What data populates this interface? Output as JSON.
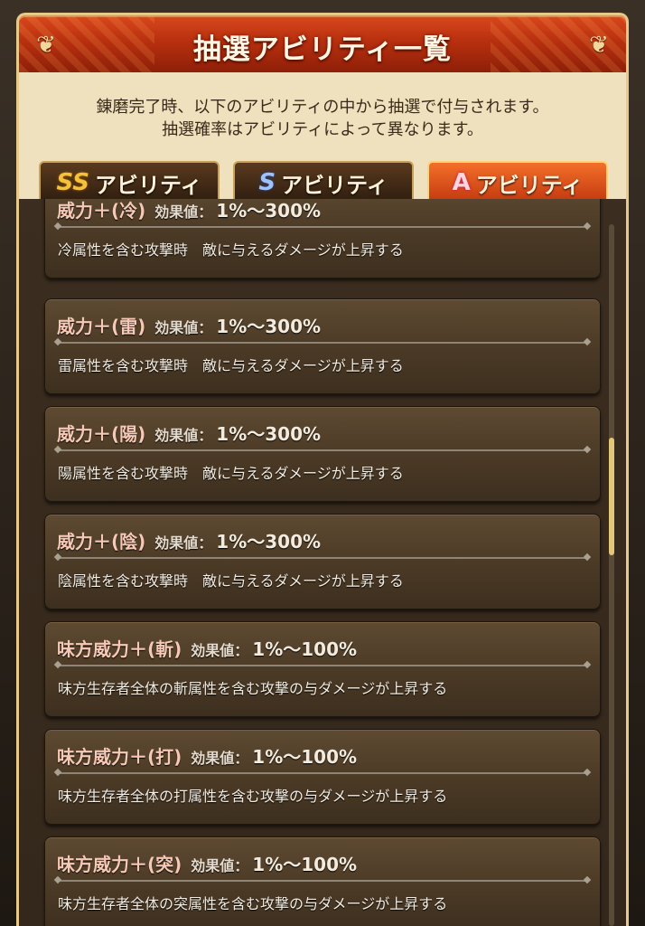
{
  "header": {
    "title": "抽選アビリティ一覧"
  },
  "description": {
    "line1": "錬磨完了時、以下のアビリティの中から抽選で付与されます。",
    "line2": "抽選確率はアビリティによって異なります。"
  },
  "tabs": [
    {
      "icon": "ss-rank-icon",
      "icon_text": "SS",
      "label": "アビリティ",
      "active": false
    },
    {
      "icon": "s-rank-icon",
      "icon_text": "S",
      "label": "アビリティ",
      "active": false
    },
    {
      "icon": "a-rank-icon",
      "icon_text": "A",
      "label": "アビリティ",
      "active": true
    }
  ],
  "abilities": [
    {
      "name": "威力＋(冷)",
      "value_label": "効果値：",
      "value": "1%〜300%",
      "desc": "冷属性を含む攻撃時　敵に与えるダメージが上昇する"
    },
    {
      "name": "威力＋(雷)",
      "value_label": "効果値：",
      "value": "1%〜300%",
      "desc": "雷属性を含む攻撃時　敵に与えるダメージが上昇する"
    },
    {
      "name": "威力＋(陽)",
      "value_label": "効果値：",
      "value": "1%〜300%",
      "desc": "陽属性を含む攻撃時　敵に与えるダメージが上昇する"
    },
    {
      "name": "威力＋(陰)",
      "value_label": "効果値：",
      "value": "1%〜300%",
      "desc": "陰属性を含む攻撃時　敵に与えるダメージが上昇する"
    },
    {
      "name": "味方威力＋(斬)",
      "value_label": "効果値：",
      "value": "1%〜100%",
      "desc": "味方生存者全体の斬属性を含む攻撃の与ダメージが上昇する"
    },
    {
      "name": "味方威力＋(打)",
      "value_label": "効果値：",
      "value": "1%〜100%",
      "desc": "味方生存者全体の打属性を含む攻撃の与ダメージが上昇する"
    },
    {
      "name": "味方威力＋(突)",
      "value_label": "効果値：",
      "value": "1%〜100%",
      "desc": "味方生存者全体の突属性を含む攻撃の与ダメージが上昇する"
    }
  ],
  "colors": {
    "header": "#c2380f",
    "panel": "#efe1bd",
    "card": "#4a3925",
    "name_text": "#f6c8b6"
  },
  "scroll_position": 0.35
}
